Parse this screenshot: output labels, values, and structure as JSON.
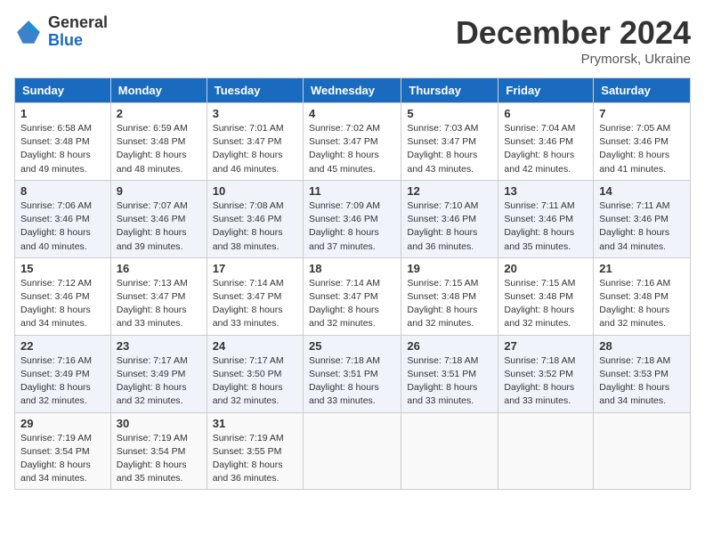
{
  "header": {
    "logo_general": "General",
    "logo_blue": "Blue",
    "title": "December 2024",
    "location": "Prymorsk, Ukraine"
  },
  "columns": [
    "Sunday",
    "Monday",
    "Tuesday",
    "Wednesday",
    "Thursday",
    "Friday",
    "Saturday"
  ],
  "weeks": [
    [
      {
        "day": "1",
        "info": "Sunrise: 6:58 AM\nSunset: 3:48 PM\nDaylight: 8 hours\nand 49 minutes."
      },
      {
        "day": "2",
        "info": "Sunrise: 6:59 AM\nSunset: 3:48 PM\nDaylight: 8 hours\nand 48 minutes."
      },
      {
        "day": "3",
        "info": "Sunrise: 7:01 AM\nSunset: 3:47 PM\nDaylight: 8 hours\nand 46 minutes."
      },
      {
        "day": "4",
        "info": "Sunrise: 7:02 AM\nSunset: 3:47 PM\nDaylight: 8 hours\nand 45 minutes."
      },
      {
        "day": "5",
        "info": "Sunrise: 7:03 AM\nSunset: 3:47 PM\nDaylight: 8 hours\nand 43 minutes."
      },
      {
        "day": "6",
        "info": "Sunrise: 7:04 AM\nSunset: 3:46 PM\nDaylight: 8 hours\nand 42 minutes."
      },
      {
        "day": "7",
        "info": "Sunrise: 7:05 AM\nSunset: 3:46 PM\nDaylight: 8 hours\nand 41 minutes."
      }
    ],
    [
      {
        "day": "8",
        "info": "Sunrise: 7:06 AM\nSunset: 3:46 PM\nDaylight: 8 hours\nand 40 minutes."
      },
      {
        "day": "9",
        "info": "Sunrise: 7:07 AM\nSunset: 3:46 PM\nDaylight: 8 hours\nand 39 minutes."
      },
      {
        "day": "10",
        "info": "Sunrise: 7:08 AM\nSunset: 3:46 PM\nDaylight: 8 hours\nand 38 minutes."
      },
      {
        "day": "11",
        "info": "Sunrise: 7:09 AM\nSunset: 3:46 PM\nDaylight: 8 hours\nand 37 minutes."
      },
      {
        "day": "12",
        "info": "Sunrise: 7:10 AM\nSunset: 3:46 PM\nDaylight: 8 hours\nand 36 minutes."
      },
      {
        "day": "13",
        "info": "Sunrise: 7:11 AM\nSunset: 3:46 PM\nDaylight: 8 hours\nand 35 minutes."
      },
      {
        "day": "14",
        "info": "Sunrise: 7:11 AM\nSunset: 3:46 PM\nDaylight: 8 hours\nand 34 minutes."
      }
    ],
    [
      {
        "day": "15",
        "info": "Sunrise: 7:12 AM\nSunset: 3:46 PM\nDaylight: 8 hours\nand 34 minutes."
      },
      {
        "day": "16",
        "info": "Sunrise: 7:13 AM\nSunset: 3:47 PM\nDaylight: 8 hours\nand 33 minutes."
      },
      {
        "day": "17",
        "info": "Sunrise: 7:14 AM\nSunset: 3:47 PM\nDaylight: 8 hours\nand 33 minutes."
      },
      {
        "day": "18",
        "info": "Sunrise: 7:14 AM\nSunset: 3:47 PM\nDaylight: 8 hours\nand 32 minutes."
      },
      {
        "day": "19",
        "info": "Sunrise: 7:15 AM\nSunset: 3:48 PM\nDaylight: 8 hours\nand 32 minutes."
      },
      {
        "day": "20",
        "info": "Sunrise: 7:15 AM\nSunset: 3:48 PM\nDaylight: 8 hours\nand 32 minutes."
      },
      {
        "day": "21",
        "info": "Sunrise: 7:16 AM\nSunset: 3:48 PM\nDaylight: 8 hours\nand 32 minutes."
      }
    ],
    [
      {
        "day": "22",
        "info": "Sunrise: 7:16 AM\nSunset: 3:49 PM\nDaylight: 8 hours\nand 32 minutes."
      },
      {
        "day": "23",
        "info": "Sunrise: 7:17 AM\nSunset: 3:49 PM\nDaylight: 8 hours\nand 32 minutes."
      },
      {
        "day": "24",
        "info": "Sunrise: 7:17 AM\nSunset: 3:50 PM\nDaylight: 8 hours\nand 32 minutes."
      },
      {
        "day": "25",
        "info": "Sunrise: 7:18 AM\nSunset: 3:51 PM\nDaylight: 8 hours\nand 33 minutes."
      },
      {
        "day": "26",
        "info": "Sunrise: 7:18 AM\nSunset: 3:51 PM\nDaylight: 8 hours\nand 33 minutes."
      },
      {
        "day": "27",
        "info": "Sunrise: 7:18 AM\nSunset: 3:52 PM\nDaylight: 8 hours\nand 33 minutes."
      },
      {
        "day": "28",
        "info": "Sunrise: 7:18 AM\nSunset: 3:53 PM\nDaylight: 8 hours\nand 34 minutes."
      }
    ],
    [
      {
        "day": "29",
        "info": "Sunrise: 7:19 AM\nSunset: 3:54 PM\nDaylight: 8 hours\nand 34 minutes."
      },
      {
        "day": "30",
        "info": "Sunrise: 7:19 AM\nSunset: 3:54 PM\nDaylight: 8 hours\nand 35 minutes."
      },
      {
        "day": "31",
        "info": "Sunrise: 7:19 AM\nSunset: 3:55 PM\nDaylight: 8 hours\nand 36 minutes."
      },
      {
        "day": "",
        "info": ""
      },
      {
        "day": "",
        "info": ""
      },
      {
        "day": "",
        "info": ""
      },
      {
        "day": "",
        "info": ""
      }
    ]
  ]
}
